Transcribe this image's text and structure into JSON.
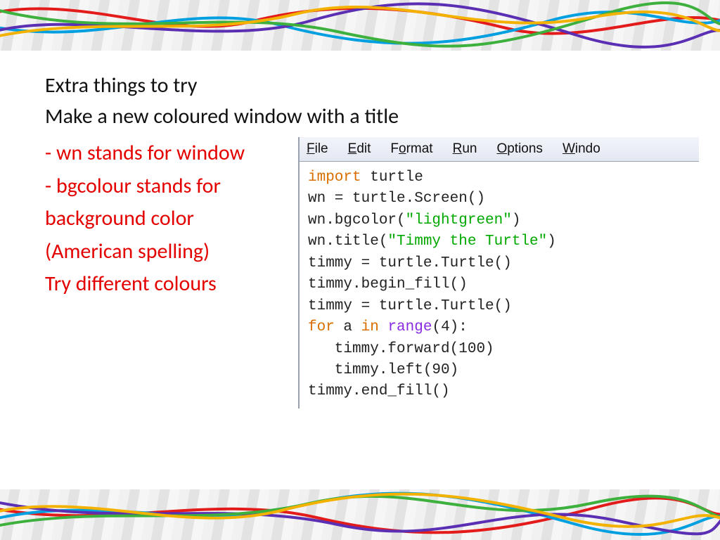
{
  "slide": {
    "title": "Extra things to try",
    "subtitle": "Make a new coloured window with a title",
    "notes": [
      "- wn stands for window",
      "- bgcolour stands for",
      "background color",
      "(American spelling)",
      "Try different colours"
    ]
  },
  "editor": {
    "menubar": {
      "file": {
        "u": "F",
        "rest": "ile"
      },
      "edit": {
        "u": "E",
        "rest": "dit"
      },
      "format": {
        "pre": "F",
        "u": "o",
        "rest": "rmat"
      },
      "run": {
        "u": "R",
        "rest": "un"
      },
      "options": {
        "u": "O",
        "rest": "ptions"
      },
      "window": {
        "u": "W",
        "rest": "indo"
      }
    },
    "code": {
      "l1_import": "import",
      "l1_turtle": " turtle",
      "l2": "wn = turtle.Screen()",
      "l3_pre": "wn.bgcolor(",
      "l3_str": "\"lightgreen\"",
      "l3_post": ")",
      "l4_pre": "wn.title(",
      "l4_str": "\"Timmy the Turtle\"",
      "l4_post": ")",
      "l5": "timmy = turtle.Turtle()",
      "l6": "timmy.begin_fill()",
      "l7": "timmy = turtle.Turtle()",
      "l8_for": "for",
      "l8_a": " a ",
      "l8_in": "in",
      "l8_sp": " ",
      "l8_range": "range",
      "l8_post": "(4):",
      "l9": "   timmy.forward(100)",
      "l10": "   timmy.left(90)",
      "l11": "timmy.end_fill()"
    }
  }
}
